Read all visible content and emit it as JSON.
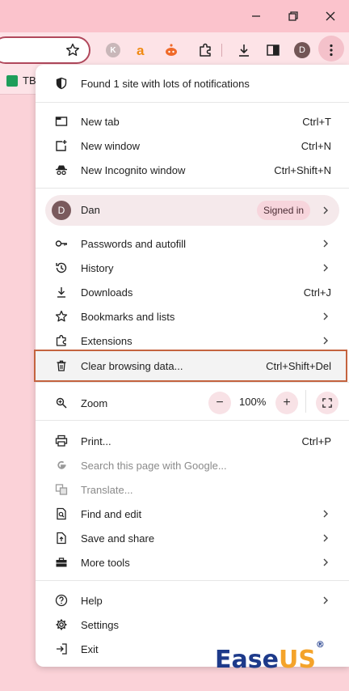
{
  "titlebar": {
    "minimize_icon": "minimize-icon",
    "restore_icon": "restore-icon",
    "close_icon": "close-icon"
  },
  "toolbar": {
    "extension_k": "K",
    "profile_initial": "D"
  },
  "bookmarks": {
    "item_label": "TB"
  },
  "menu": {
    "notification": "Found 1 site with lots of notifications",
    "new_tab": {
      "label": "New tab",
      "shortcut": "Ctrl+T"
    },
    "new_window": {
      "label": "New window",
      "shortcut": "Ctrl+N"
    },
    "incognito": {
      "label": "New Incognito window",
      "shortcut": "Ctrl+Shift+N"
    },
    "profile": {
      "initial": "D",
      "name": "Dan",
      "status": "Signed in"
    },
    "passwords": {
      "label": "Passwords and autofill"
    },
    "history": {
      "label": "History"
    },
    "downloads": {
      "label": "Downloads",
      "shortcut": "Ctrl+J"
    },
    "bookmarks": {
      "label": "Bookmarks and lists"
    },
    "extensions": {
      "label": "Extensions"
    },
    "clear_data": {
      "label": "Clear browsing data...",
      "shortcut": "Ctrl+Shift+Del"
    },
    "zoom": {
      "label": "Zoom",
      "minus": "−",
      "value": "100%",
      "plus": "+"
    },
    "print": {
      "label": "Print...",
      "shortcut": "Ctrl+P"
    },
    "search_page": {
      "label": "Search this page with Google..."
    },
    "translate": {
      "label": "Translate..."
    },
    "find_edit": {
      "label": "Find and edit"
    },
    "save_share": {
      "label": "Save and share"
    },
    "more_tools": {
      "label": "More tools"
    },
    "help": {
      "label": "Help"
    },
    "settings": {
      "label": "Settings"
    },
    "exit": {
      "label": "Exit"
    }
  },
  "watermark": {
    "part1": "Ease",
    "part2": "US",
    "mark": "®"
  },
  "colors": {
    "highlight_border": "#c4633f",
    "page_bg": "#fbd2d8",
    "profile_pill": "#f7d5dc"
  }
}
